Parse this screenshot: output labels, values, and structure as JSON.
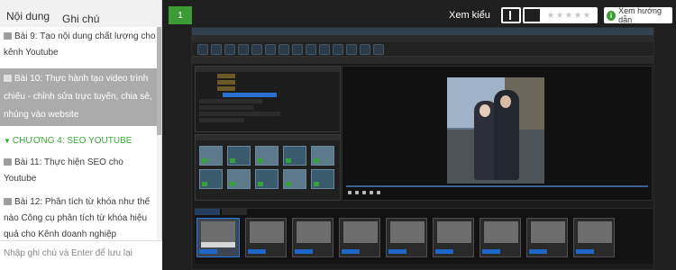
{
  "sidebar": {
    "tabs": [
      {
        "label": "Nội dung",
        "active": true
      },
      {
        "label": "Ghi chú",
        "active": false
      }
    ],
    "items": [
      {
        "type": "lesson",
        "label": "Bài 9: Tạo nội dung chất lượng cho kênh Youtube",
        "active": false
      },
      {
        "type": "lesson",
        "label": "Bài 10: Thực hành tạo video trình chiếu - chỉnh sửa trực tuyến, chia sẻ, nhúng vào website",
        "active": true
      },
      {
        "type": "chapter",
        "label": "CHƯƠNG 4: SEO YOUTUBE"
      },
      {
        "type": "lesson",
        "label": "Bài 11: Thực hiện SEO cho Youtube",
        "active": false
      },
      {
        "type": "lesson",
        "label": "Bài 12: Phân tích từ khóa như thế nào Công cụ phân tích từ khóa hiệu quả cho Kênh doanh nghiệp",
        "active": false
      }
    ],
    "note_placeholder": "Nhập ghi chú và Enter để lưu lại"
  },
  "topbar": {
    "lesson_number": "1",
    "view_label": "Xem kiểu",
    "rating": 0,
    "rating_max": 5,
    "guide_label": "Xem hướng dẫn"
  },
  "colors": {
    "accent_green": "#3d9b35",
    "active_item_bg": "#ababab",
    "chapter_text": "#39a935"
  }
}
